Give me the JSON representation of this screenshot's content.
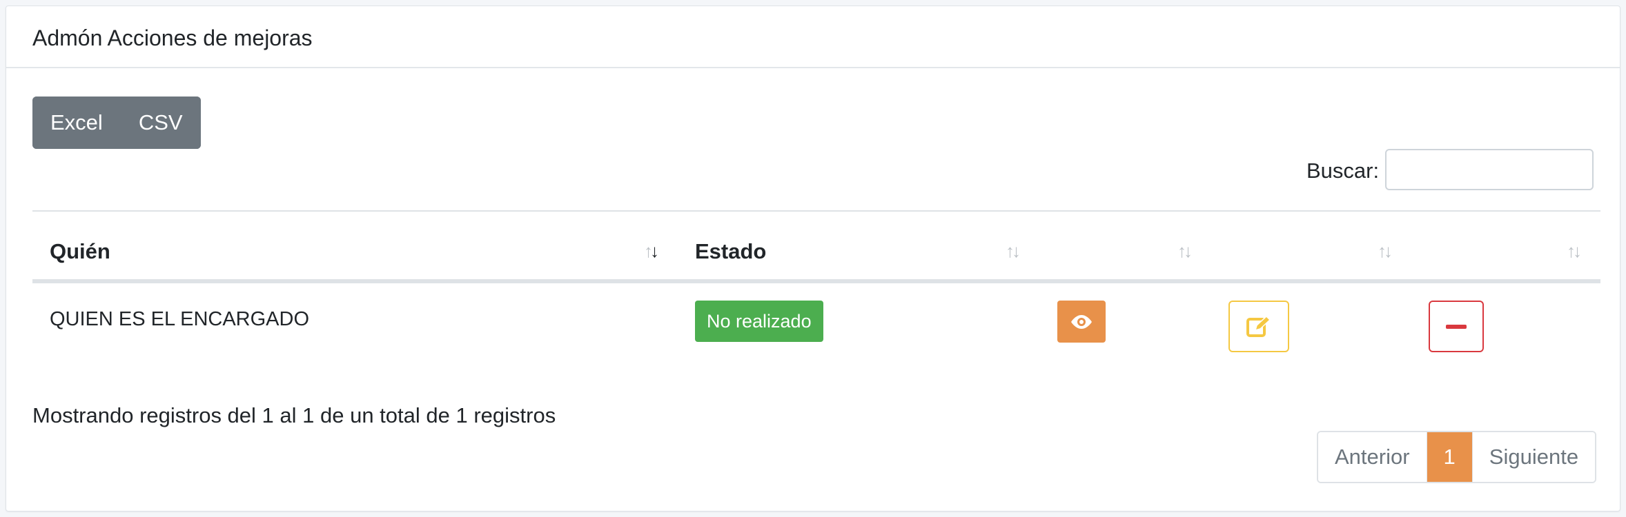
{
  "card": {
    "title": "Admón Acciones de mejoras"
  },
  "export": {
    "buttons": [
      "Excel",
      "CSV"
    ]
  },
  "search": {
    "label": "Buscar:",
    "value": "",
    "placeholder": ""
  },
  "table": {
    "columns": [
      "Quién",
      "Estado",
      "",
      "",
      "",
      ""
    ],
    "rows": [
      {
        "quien": "QUIEN ES EL ENCARGADO",
        "estado": "No realizado",
        "actions": [
          "eye-icon",
          "edit-icon",
          "minus-icon"
        ]
      }
    ]
  },
  "info": "Mostrando registros del 1 al 1 de un total de 1 registros",
  "pagination": {
    "previous": "Anterior",
    "current": "1",
    "next": "Siguiente"
  },
  "colors": {
    "export_bg": "#6c757d",
    "badge_success": "#4cae4f",
    "accent_orange": "#e8914a",
    "edit_border": "#f5c842",
    "delete_border": "#d9383e"
  }
}
